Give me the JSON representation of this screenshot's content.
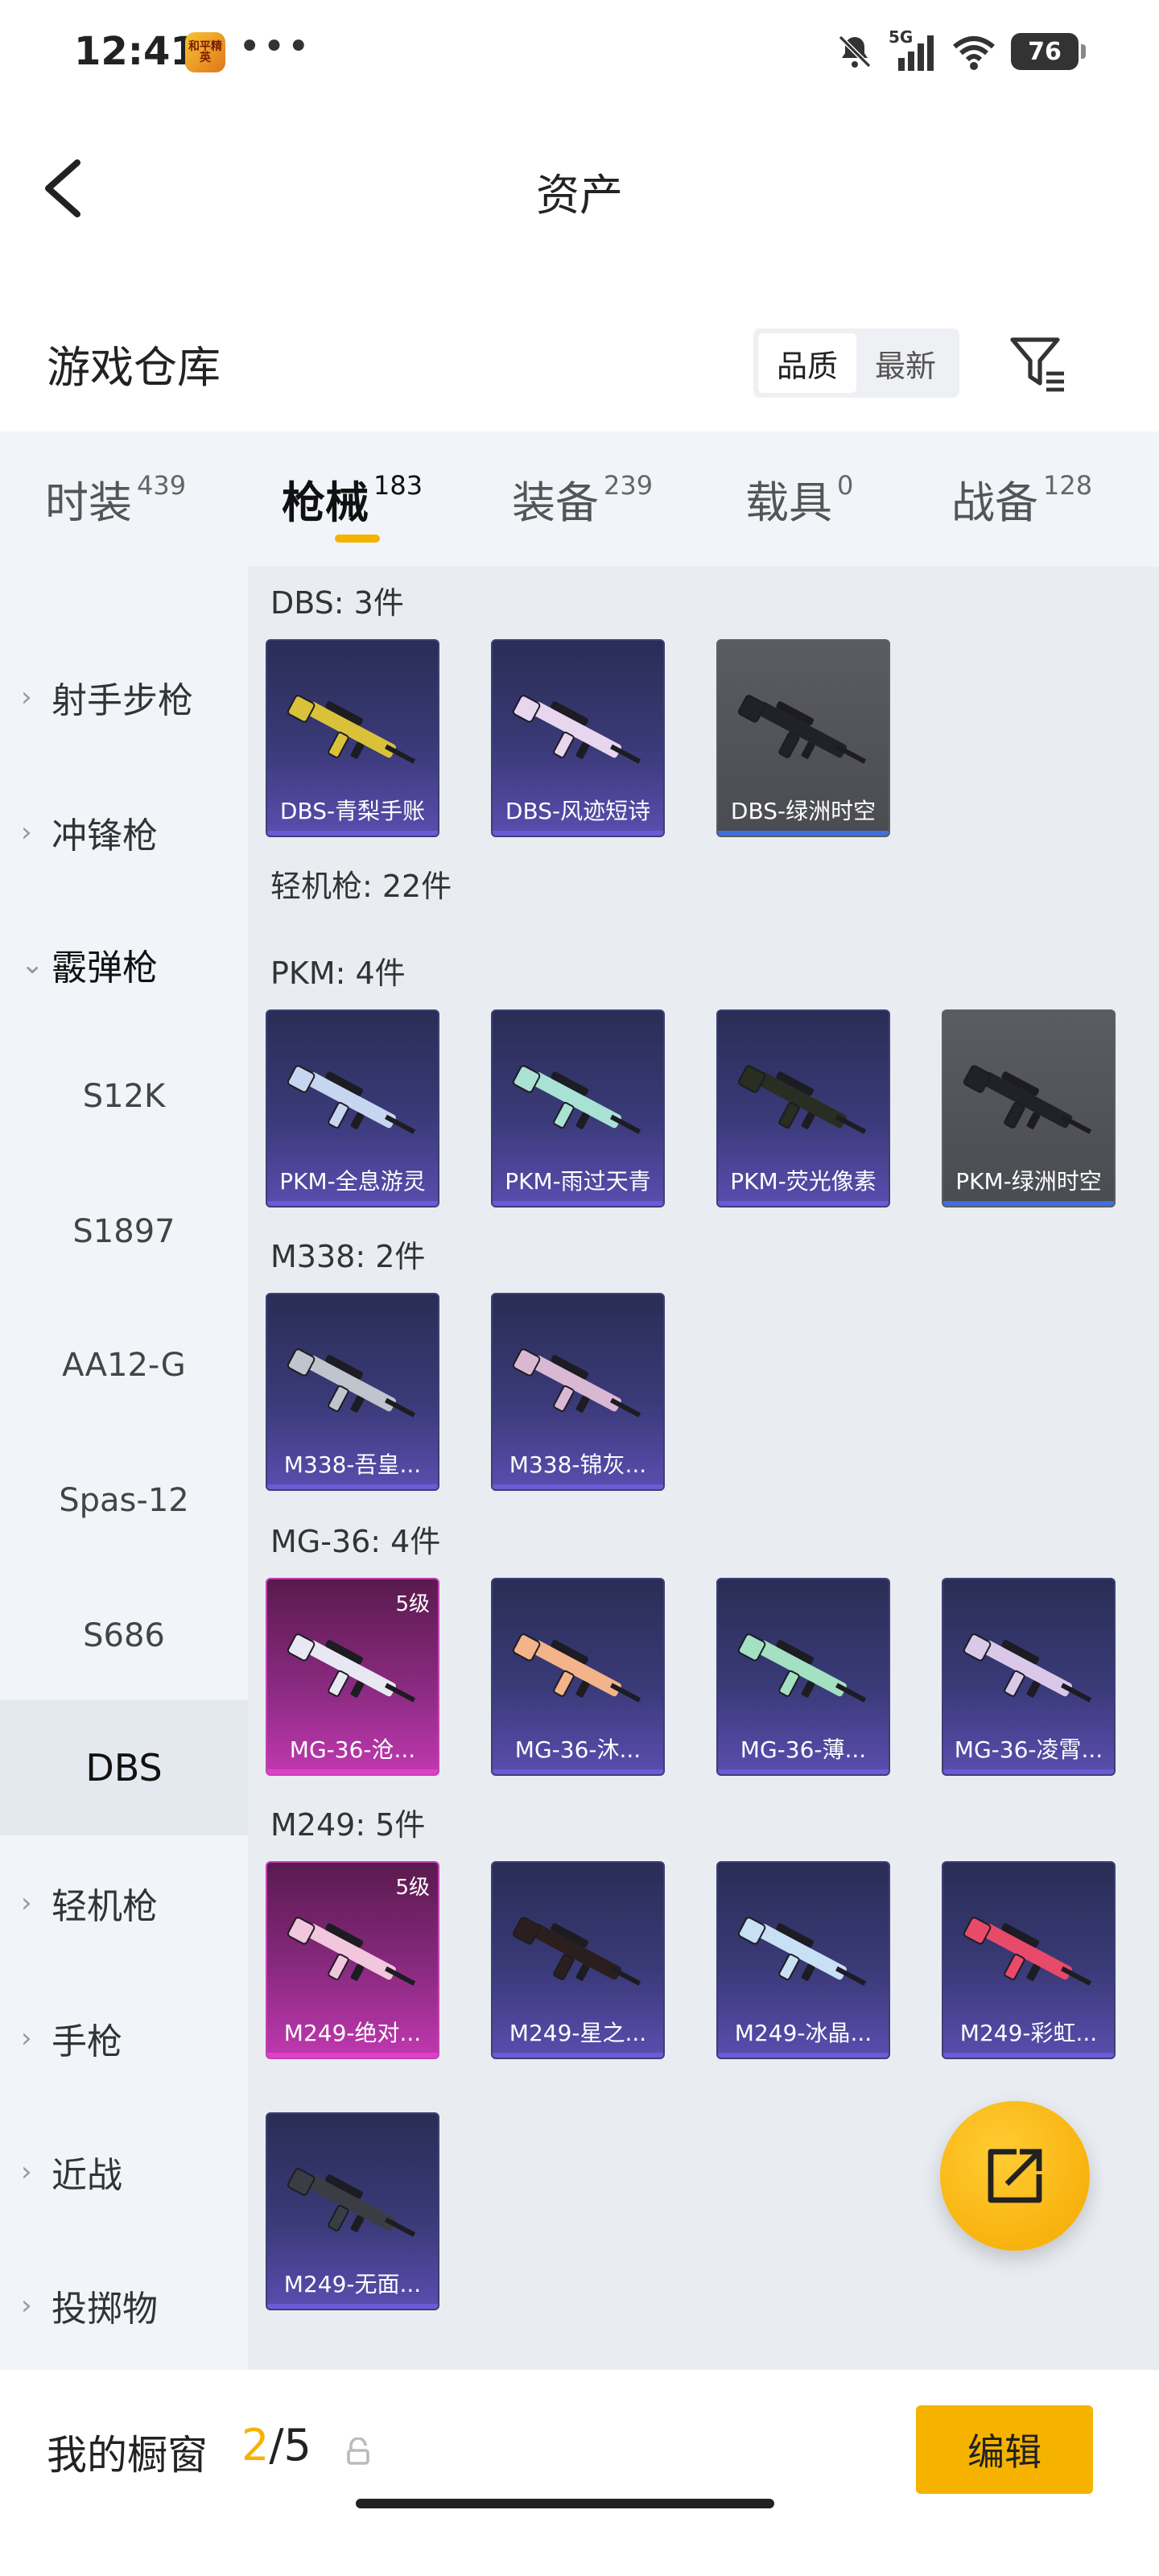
{
  "status": {
    "time": "12:41",
    "app_badge": "和平精英",
    "dots": "•••",
    "battery": "76",
    "network": "5G"
  },
  "header": {
    "title": "资产"
  },
  "section": {
    "title": "游戏仓库",
    "sort_options": [
      "品质",
      "最新"
    ],
    "active_sort": "品质"
  },
  "tabs": [
    {
      "label": "时装",
      "count": "439"
    },
    {
      "label": "枪械",
      "count": "183"
    },
    {
      "label": "装备",
      "count": "239"
    },
    {
      "label": "载具",
      "count": "0"
    },
    {
      "label": "战备",
      "count": "128"
    }
  ],
  "active_tab": "枪械",
  "sidebar": {
    "items": [
      {
        "label": "射手步枪",
        "chev": "›"
      },
      {
        "label": "冲锋枪",
        "chev": "›"
      },
      {
        "label": "霰弹枪",
        "chev": "⌄"
      },
      {
        "label": "S12K"
      },
      {
        "label": "S1897"
      },
      {
        "label": "AA12-G"
      },
      {
        "label": "Spas-12"
      },
      {
        "label": "S686"
      },
      {
        "label": "DBS"
      },
      {
        "label": "轻机枪",
        "chev": "›"
      },
      {
        "label": "手枪",
        "chev": "›"
      },
      {
        "label": "近战",
        "chev": "›"
      },
      {
        "label": "投掷物",
        "chev": "›"
      }
    ]
  },
  "content": {
    "groups": [
      {
        "title": "DBS: 3件",
        "items": [
          {
            "name": "DBS-青梨手账",
            "style": "purple",
            "color": "#d9c23a"
          },
          {
            "name": "DBS-风迹短诗",
            "style": "purple",
            "color": "#e8d6ef"
          },
          {
            "name": "DBS-绿洲时空",
            "style": "grey",
            "color": "#1f2226"
          }
        ]
      },
      {
        "title": "轻机枪: 22件",
        "items": []
      },
      {
        "title": "PKM: 4件",
        "items": [
          {
            "name": "PKM-全息游灵",
            "style": "purple",
            "color": "#c7d6f0"
          },
          {
            "name": "PKM-雨过天青",
            "style": "purple",
            "color": "#a9e1d4"
          },
          {
            "name": "PKM-荧光像素",
            "style": "purple",
            "color": "#2a2d22"
          },
          {
            "name": "PKM-绿洲时空",
            "style": "grey",
            "color": "#1f2226"
          }
        ]
      },
      {
        "title": "M338: 2件",
        "items": [
          {
            "name": "M338-吾皇...",
            "style": "purple",
            "color": "#c0c4cc"
          },
          {
            "name": "M338-锦灰...",
            "style": "purple",
            "color": "#d9b8d4"
          }
        ]
      },
      {
        "title": "MG-36: 4件",
        "items": [
          {
            "name": "MG-36-沧...",
            "style": "pink",
            "color": "#e8e8f2",
            "level": "5级"
          },
          {
            "name": "MG-36-沐...",
            "style": "purple",
            "color": "#f3b48a"
          },
          {
            "name": "MG-36-薄...",
            "style": "purple",
            "color": "#a4e0c2"
          },
          {
            "name": "MG-36-凌霄...",
            "style": "purple",
            "color": "#d9c8e8"
          }
        ]
      },
      {
        "title": "M249: 5件",
        "items": [
          {
            "name": "M249-绝对...",
            "style": "pink",
            "color": "#f2c6dc",
            "level": "5级"
          },
          {
            "name": "M249-星之...",
            "style": "purple",
            "color": "#2b1e1e"
          },
          {
            "name": "M249-冰晶...",
            "style": "purple",
            "color": "#c8e0f4"
          },
          {
            "name": "M249-彩虹...",
            "style": "purple",
            "color": "#e84a6a"
          },
          {
            "name": "M249-无面...",
            "style": "purple",
            "color": "#3a3e44"
          }
        ]
      }
    ]
  },
  "bottom": {
    "label": "我的橱窗",
    "current": "2",
    "total": "/5",
    "edit": "编辑"
  },
  "colors": {
    "accent": "#f5b300",
    "purple_bar": "#6b5bd6"
  }
}
